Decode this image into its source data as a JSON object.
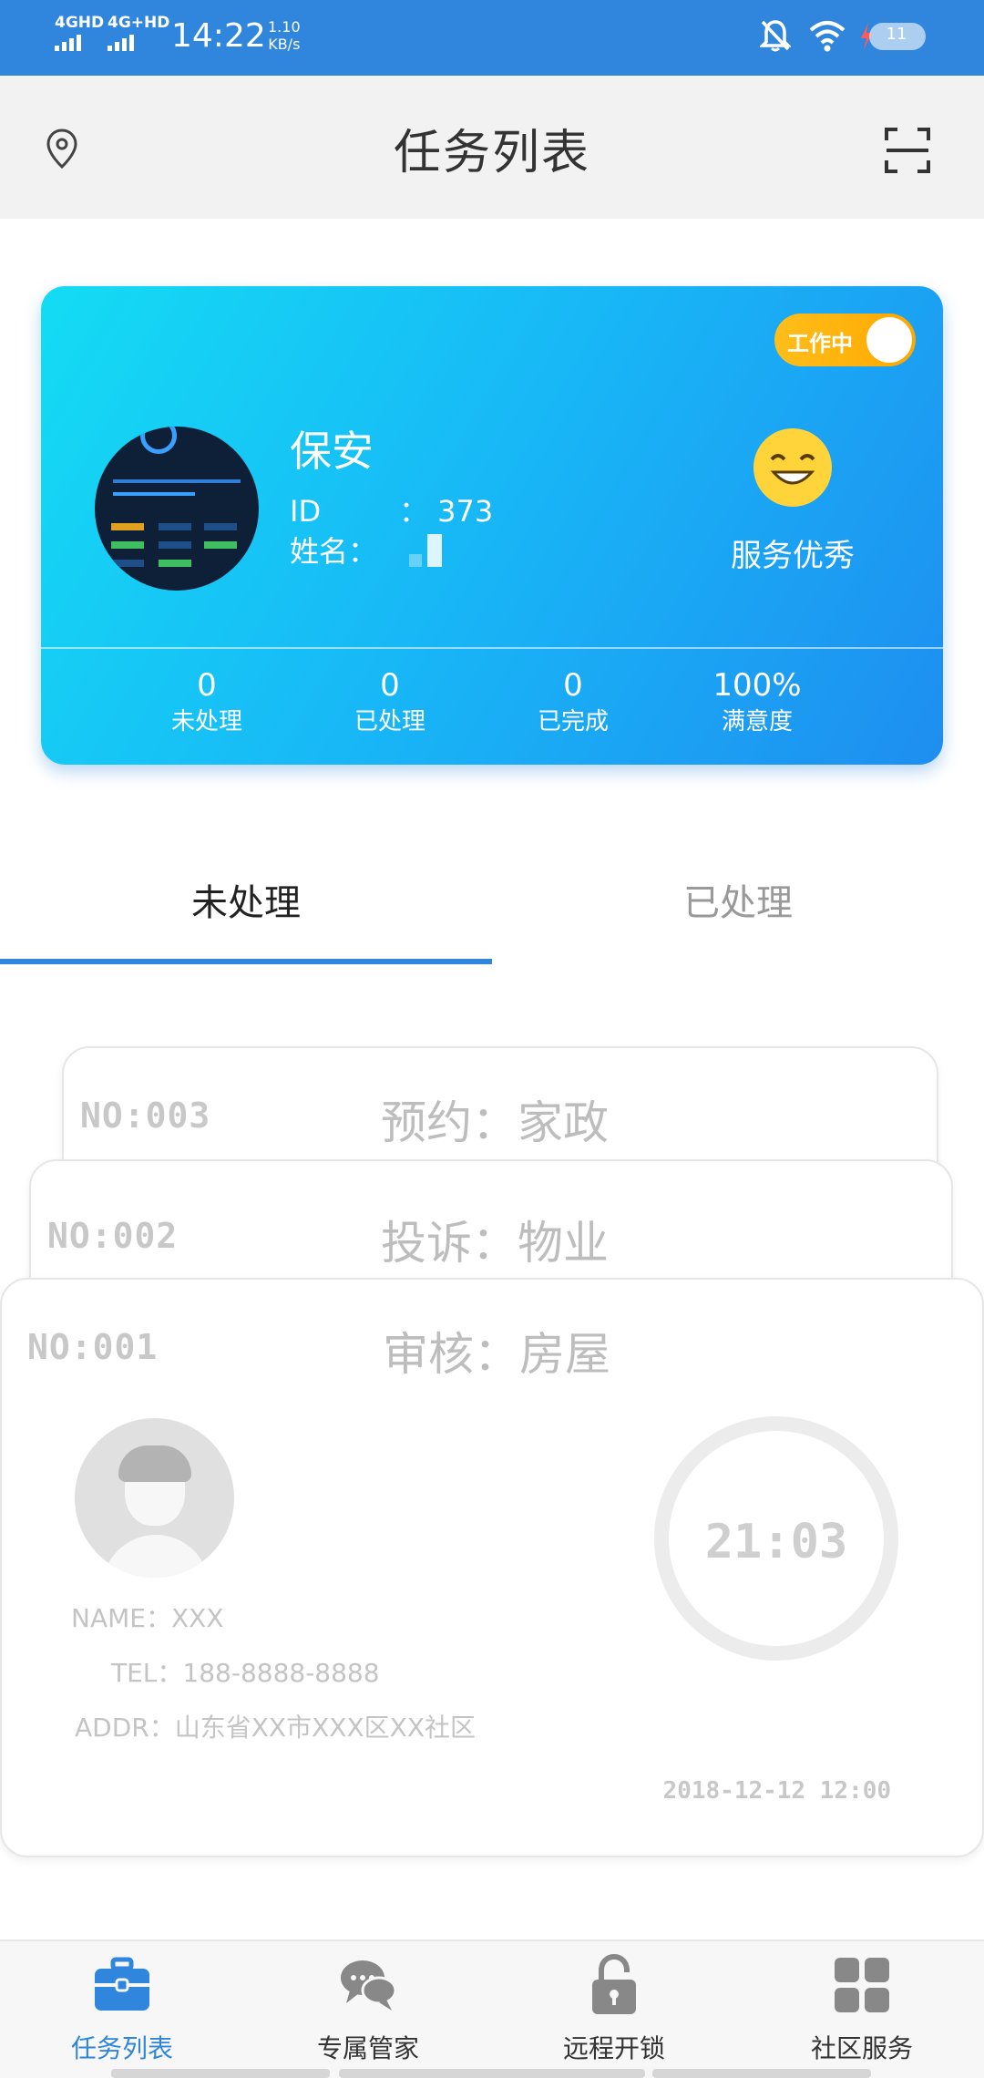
{
  "status_bar": {
    "net1": "4GHD",
    "net2": "4G+HD",
    "time": "14:22",
    "speed_value": "1.10",
    "speed_unit": "KB/s",
    "battery": "11"
  },
  "header": {
    "title": "任务列表"
  },
  "profile": {
    "toggle_label": "工作中",
    "role": "保安",
    "id_label": "ID",
    "id_value": "： 373",
    "name_label": "姓名：",
    "rating_text": "服务优秀",
    "stats": [
      {
        "value": "0",
        "label": "未处理"
      },
      {
        "value": "0",
        "label": "已处理"
      },
      {
        "value": "0",
        "label": "已完成"
      },
      {
        "value": "100%",
        "label": "满意度"
      }
    ]
  },
  "tabs": [
    {
      "label": "未处理"
    },
    {
      "label": "已处理"
    }
  ],
  "tasks": [
    {
      "no": "NO:003",
      "type": "预约：家政"
    },
    {
      "no": "NO:002",
      "type": "投诉：物业"
    },
    {
      "no": "NO:001",
      "type": "审核：房屋",
      "name": "NAME：XXX",
      "tel": "TEL：188-8888-8888",
      "addr": "ADDR：山东省XX市XXX区XX社区",
      "timer": "21:03",
      "datetime": "2018-12-12   12:00"
    }
  ],
  "bottom_nav": [
    {
      "label": "任务列表",
      "icon": "briefcase-icon"
    },
    {
      "label": "专属管家",
      "icon": "chat-bubbles-icon"
    },
    {
      "label": "远程开锁",
      "icon": "lock-icon"
    },
    {
      "label": "社区服务",
      "icon": "grid-icon"
    }
  ],
  "colors": {
    "primary": "#2f86dc",
    "card_gradient_start": "#14dcf4",
    "card_gradient_end": "#1e8ef0",
    "toggle": "#ffb000"
  }
}
